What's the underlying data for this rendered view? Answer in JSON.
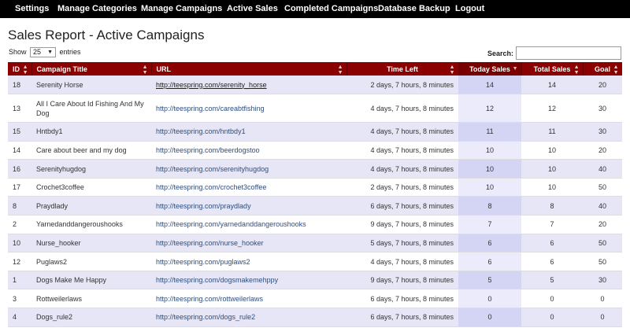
{
  "nav": {
    "items": [
      {
        "label": "Settings"
      },
      {
        "label": "Manage Categories"
      },
      {
        "label": "Manage Campaigns"
      },
      {
        "label": "Active Sales"
      },
      {
        "label": "Completed Campaigns"
      },
      {
        "label": "Database Backup"
      },
      {
        "label": "Logout"
      }
    ]
  },
  "page": {
    "title": "Sales Report - Active Campaigns"
  },
  "length": {
    "show_label": "Show",
    "value": "25",
    "entries_label": "entries"
  },
  "search": {
    "label": "Search:",
    "value": ""
  },
  "table": {
    "columns": [
      "ID",
      "Campaign Title",
      "URL",
      "Time Left",
      "Today Sales",
      "Total Sales",
      "Goal"
    ],
    "rows": [
      {
        "id": "18",
        "title": "Serenity Horse",
        "url": "http://teespring.com/serenity_horse",
        "time": "2 days, 7 hours, 8 minutes",
        "today": "14",
        "total": "14",
        "goal": "20"
      },
      {
        "id": "13",
        "title": "All I Care About Id Fishing And My Dog",
        "url": "http://teespring.com/careabtfishing",
        "time": "4 days, 7 hours, 8 minutes",
        "today": "12",
        "total": "12",
        "goal": "30"
      },
      {
        "id": "15",
        "title": "Hntbdy1",
        "url": "http://teespring.com/hntbdy1",
        "time": "4 days, 7 hours, 8 minutes",
        "today": "11",
        "total": "11",
        "goal": "30"
      },
      {
        "id": "14",
        "title": "Care about beer and my dog",
        "url": "http://teespring.com/beerdogstoo",
        "time": "4 days, 7 hours, 8 minutes",
        "today": "10",
        "total": "10",
        "goal": "20"
      },
      {
        "id": "16",
        "title": "Serenityhugdog",
        "url": "http://teespring.com/serenityhugdog",
        "time": "4 days, 7 hours, 8 minutes",
        "today": "10",
        "total": "10",
        "goal": "40"
      },
      {
        "id": "17",
        "title": "Crochet3coffee",
        "url": "http://teespring.com/crochet3coffee",
        "time": "2 days, 7 hours, 8 minutes",
        "today": "10",
        "total": "10",
        "goal": "50"
      },
      {
        "id": "8",
        "title": "Praydlady",
        "url": "http://teespring.com/praydlady",
        "time": "6 days, 7 hours, 8 minutes",
        "today": "8",
        "total": "8",
        "goal": "40"
      },
      {
        "id": "2",
        "title": "Yarnedanddangeroushooks",
        "url": "http://teespring.com/yarnedanddangeroushooks",
        "time": "9 days, 7 hours, 8 minutes",
        "today": "7",
        "total": "7",
        "goal": "20"
      },
      {
        "id": "10",
        "title": "Nurse_hooker",
        "url": "http://teespring.com/nurse_hooker",
        "time": "5 days, 7 hours, 8 minutes",
        "today": "6",
        "total": "6",
        "goal": "50"
      },
      {
        "id": "12",
        "title": "Puglaws2",
        "url": "http://teespring.com/puglaws2",
        "time": "4 days, 7 hours, 8 minutes",
        "today": "6",
        "total": "6",
        "goal": "50"
      },
      {
        "id": "1",
        "title": "Dogs Make Me Happy",
        "url": "http://teespring.com/dogsmakemehppy",
        "time": "9 days, 7 hours, 8 minutes",
        "today": "5",
        "total": "5",
        "goal": "30"
      },
      {
        "id": "3",
        "title": "Rottweilerlaws",
        "url": "http://teespring.com/rottweilerlaws",
        "time": "6 days, 7 hours, 8 minutes",
        "today": "0",
        "total": "0",
        "goal": "0"
      },
      {
        "id": "4",
        "title": "Dogs_rule2",
        "url": "http://teespring.com/dogs_rule2",
        "time": "6 days, 7 hours, 8 minutes",
        "today": "0",
        "total": "0",
        "goal": "0"
      }
    ]
  },
  "colors": {
    "nav_bg": "#000000",
    "header_bg": "#8b0000",
    "row_odd": "#e6e6f6",
    "sorted_col": "#d4d4f4",
    "link": "#2e4e7e"
  }
}
